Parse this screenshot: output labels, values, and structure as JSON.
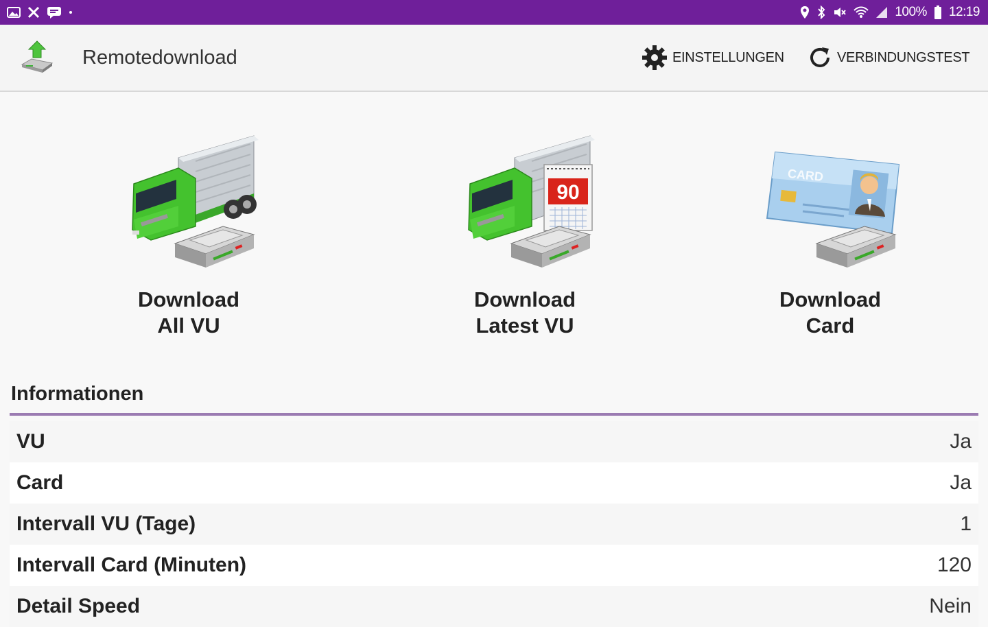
{
  "status_bar": {
    "battery": "100%",
    "time": "12:19",
    "left_icons": [
      "image-icon",
      "tools-icon",
      "chat-icon",
      "dot-icon"
    ],
    "right_icons": [
      "location-icon",
      "bluetooth-icon",
      "mute-icon",
      "wifi-icon",
      "signal-icon",
      "battery-icon"
    ]
  },
  "app_bar": {
    "title": "Remotedownload",
    "actions": [
      {
        "label": "EINSTELLUNGEN",
        "icon": "gear-icon"
      },
      {
        "label": "VERBINDUNGSTEST",
        "icon": "refresh-icon"
      }
    ]
  },
  "tiles": [
    {
      "line1": "Download",
      "line2": "All VU",
      "icon": "truck-download-icon"
    },
    {
      "line1": "Download",
      "line2": "Latest VU",
      "icon": "truck-calendar-download-icon",
      "calendar_number": "90"
    },
    {
      "line1": "Download",
      "line2": "Card",
      "icon": "card-download-icon",
      "card_text": "CARD"
    }
  ],
  "info": {
    "title": "Informationen",
    "rows": [
      {
        "label": "VU",
        "value": "Ja"
      },
      {
        "label": "Card",
        "value": "Ja"
      },
      {
        "label": "Intervall VU (Tage)",
        "value": "1"
      },
      {
        "label": "Intervall Card (Minuten)",
        "value": "120"
      },
      {
        "label": "Detail Speed",
        "value": "Nein"
      }
    ]
  },
  "colors": {
    "status_bar": "#6f1f9a",
    "divider": "#9b7bb2",
    "truck_green": "#44c22e",
    "calendar_red": "#d9241a"
  }
}
